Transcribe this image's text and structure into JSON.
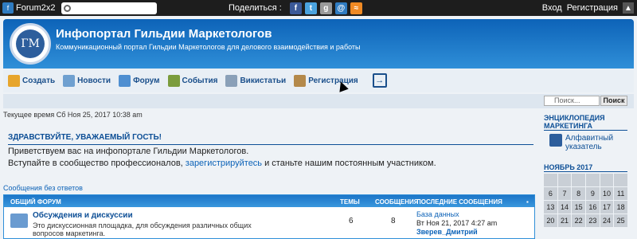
{
  "topbar": {
    "brand": "Forum2x2",
    "share": "Поделиться :",
    "login": "Вход",
    "register": "Регистрация"
  },
  "header": {
    "logo_text": "ГМ",
    "title": "Инфопортал Гильдии Маркетологов",
    "subtitle": "Коммуникационный портал Гильдии Маркетологов для делового взаимодействия и работы"
  },
  "nav": [
    {
      "label": "Создать",
      "color": "#e7a52c"
    },
    {
      "label": "Новости",
      "color": "#6fa0d0"
    },
    {
      "label": "Форум",
      "color": "#4f8fd1"
    },
    {
      "label": "События",
      "color": "#7b9c3d"
    },
    {
      "label": "Викистатьи",
      "color": "#8aa0b8"
    },
    {
      "label": "Регистрация",
      "color": "#b4894a"
    }
  ],
  "time": "Текущее время Сб Ноя 25, 2017 10:38 am",
  "search": {
    "placeholder": "Поиск...",
    "button": "Поиск"
  },
  "welcome": {
    "title": "ЗДРАВСТВУЙТЕ, УВАЖАЕМЫЙ ГОСТЬ!",
    "line1": "Приветствуем вас на инфопортале Гильдии Маркетологов.",
    "line2_before": "Вступайте в сообщество профессионалов, ",
    "line2_link": "зарегистрируйтесь",
    "line2_after": " и станьте нашим постоянным участником."
  },
  "no_answers": "Сообщения без ответов",
  "forum_table": {
    "headers": {
      "forum": "ОБЩИЙ ФОРУМ",
      "topics": "ТЕМЫ",
      "posts": "СООБЩЕНИЯ",
      "last": "ПОСЛЕДНИЕ СООБЩЕНИЯ"
    },
    "row": {
      "name": "Обсуждения и дискуссии",
      "desc": "Это дискуссионная площадка, для обсуждения различных общих вопросов маркетинга.",
      "topics": "6",
      "posts": "8",
      "last_topic": "База данных",
      "last_date": "Вт Ноя 21, 2017 4:27 am",
      "last_user": "Зверев_Дмитрий"
    }
  },
  "sidebar": {
    "encyc_title": "ЭНЦИКЛОПЕДИЯ МАРКЕТИНГА",
    "encyc_link_1": "Алфавитный",
    "encyc_link_2": "указатель",
    "cal_title": "НОЯБРЬ 2017",
    "cal_cells": [
      "",
      "",
      "",
      "",
      "",
      "",
      "6",
      "7",
      "8",
      "9",
      "10",
      "11",
      "13",
      "14",
      "15",
      "16",
      "17",
      "18",
      "20",
      "21",
      "22",
      "23",
      "24",
      "25"
    ]
  }
}
